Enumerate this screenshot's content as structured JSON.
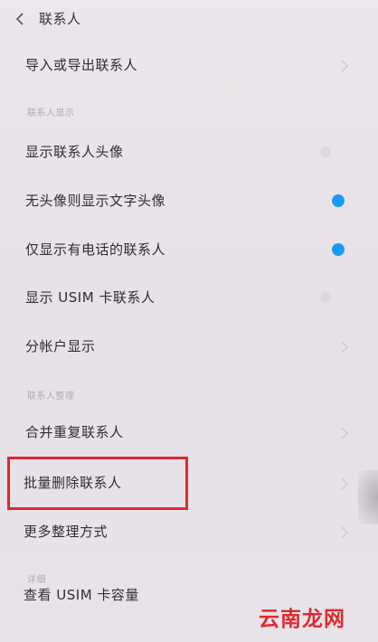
{
  "header": {
    "title": "联系人"
  },
  "rows": [
    {
      "label": "导入或导出联系人",
      "control": "chevron"
    },
    {
      "label": "显示联系人头像",
      "control": "dot-off"
    },
    {
      "label": "无头像则显示文字头像",
      "control": "dot-on"
    },
    {
      "label": "仅显示有电话的联系人",
      "control": "dot-on"
    },
    {
      "label": "显示 USIM 卡联系人",
      "control": "dot-off"
    },
    {
      "label": "分帐户显示",
      "control": "chevron"
    },
    {
      "label": "合并重复联系人",
      "control": "chevron"
    },
    {
      "label": "批量删除联系人",
      "control": "chevron",
      "highlighted": true
    },
    {
      "label": "更多整理方式",
      "control": "chevron"
    },
    {
      "label": "查看 USIM 卡容量",
      "control": "none"
    }
  ],
  "sections": {
    "display": "联系人显示",
    "organize": "联系人整理",
    "details": "详细"
  },
  "watermark": "云南龙网",
  "colors": {
    "background": "#e9e5e9",
    "toggle_on": "#1a9bf0",
    "highlight_box": "#e5262d",
    "watermark": "#e0292f"
  },
  "icons": {
    "back": "chevron-left-icon",
    "row_arrow": "chevron-right-icon"
  }
}
